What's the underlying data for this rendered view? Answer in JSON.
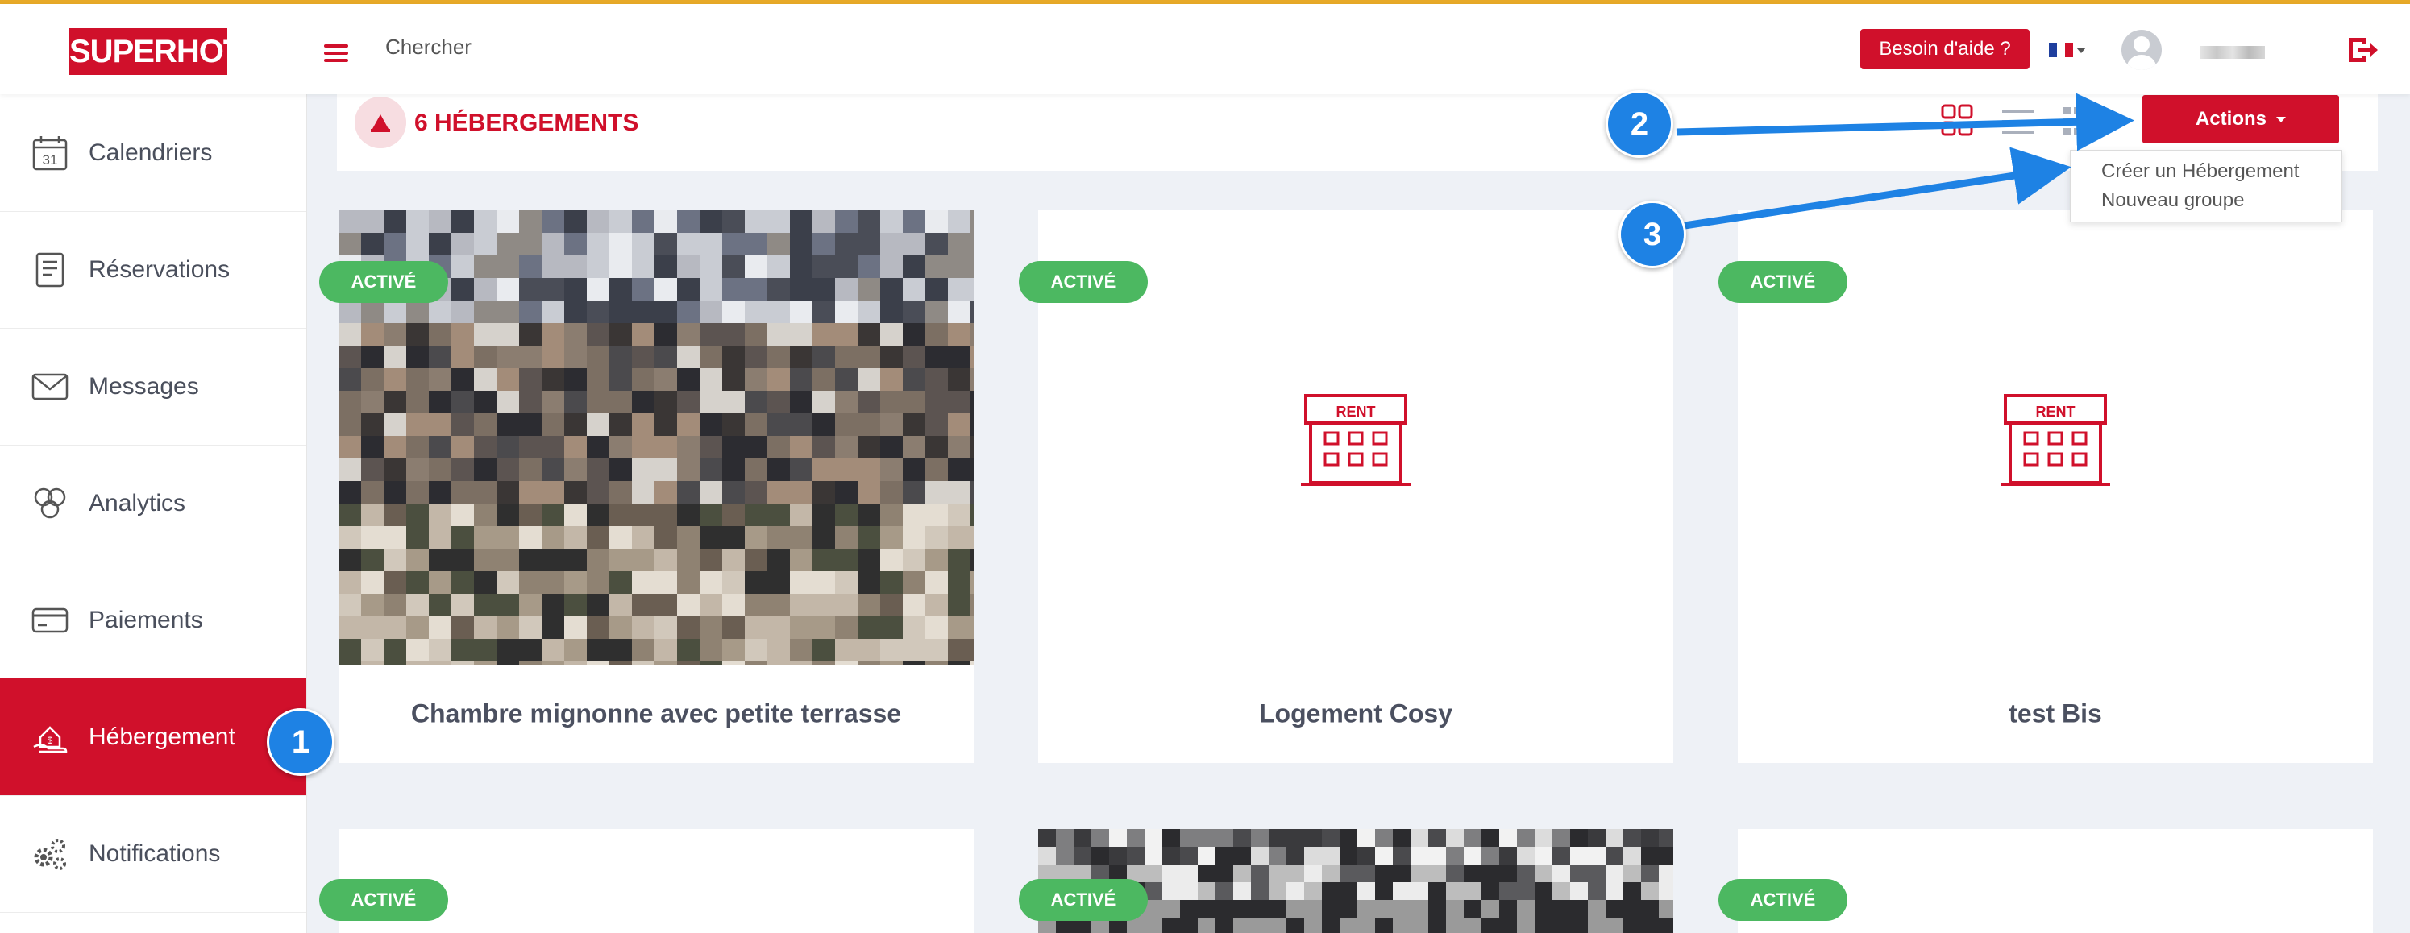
{
  "header": {
    "logo": "SUPERHOTE",
    "search_placeholder": "Chercher",
    "help_button": "Besoin d'aide ?",
    "language_icon": "france-flag-icon",
    "colors": {
      "brand": "#d0102b",
      "top_accent": "#e7a928"
    }
  },
  "sidebar": {
    "items": [
      {
        "label": "Calendriers",
        "icon": "calendar-icon",
        "icon_text": "31"
      },
      {
        "label": "Réservations",
        "icon": "reservations-icon"
      },
      {
        "label": "Messages",
        "icon": "envelope-icon"
      },
      {
        "label": "Analytics",
        "icon": "analytics-icon"
      },
      {
        "label": "Paiements",
        "icon": "credit-card-icon"
      },
      {
        "label": "Hébergement",
        "icon": "house-dollar-icon",
        "active": true
      },
      {
        "label": "Notifications",
        "icon": "gears-icon"
      }
    ]
  },
  "main": {
    "title": "6 HÉBERGEMENTS",
    "actions_button": "Actions",
    "dropdown": [
      "Créer un Hébergement",
      "Nouveau groupe"
    ],
    "cards": [
      {
        "status": "ACTIVÉ",
        "title": "Chambre mignonne avec petite terrasse",
        "image": "photo"
      },
      {
        "status": "ACTIVÉ",
        "title": "Logement Cosy",
        "image": "rent-icon",
        "icon_text": "RENT"
      },
      {
        "status": "ACTIVÉ",
        "title": "test Bis",
        "image": "rent-icon",
        "icon_text": "RENT"
      },
      {
        "status": "ACTIVÉ",
        "title": "",
        "image": "none"
      },
      {
        "status": "ACTIVÉ",
        "title": "",
        "image": "photo"
      },
      {
        "status": "ACTIVÉ",
        "title": "",
        "image": "none"
      }
    ],
    "status_color": "#4cb861"
  },
  "annotations": [
    "1",
    "2",
    "3"
  ]
}
